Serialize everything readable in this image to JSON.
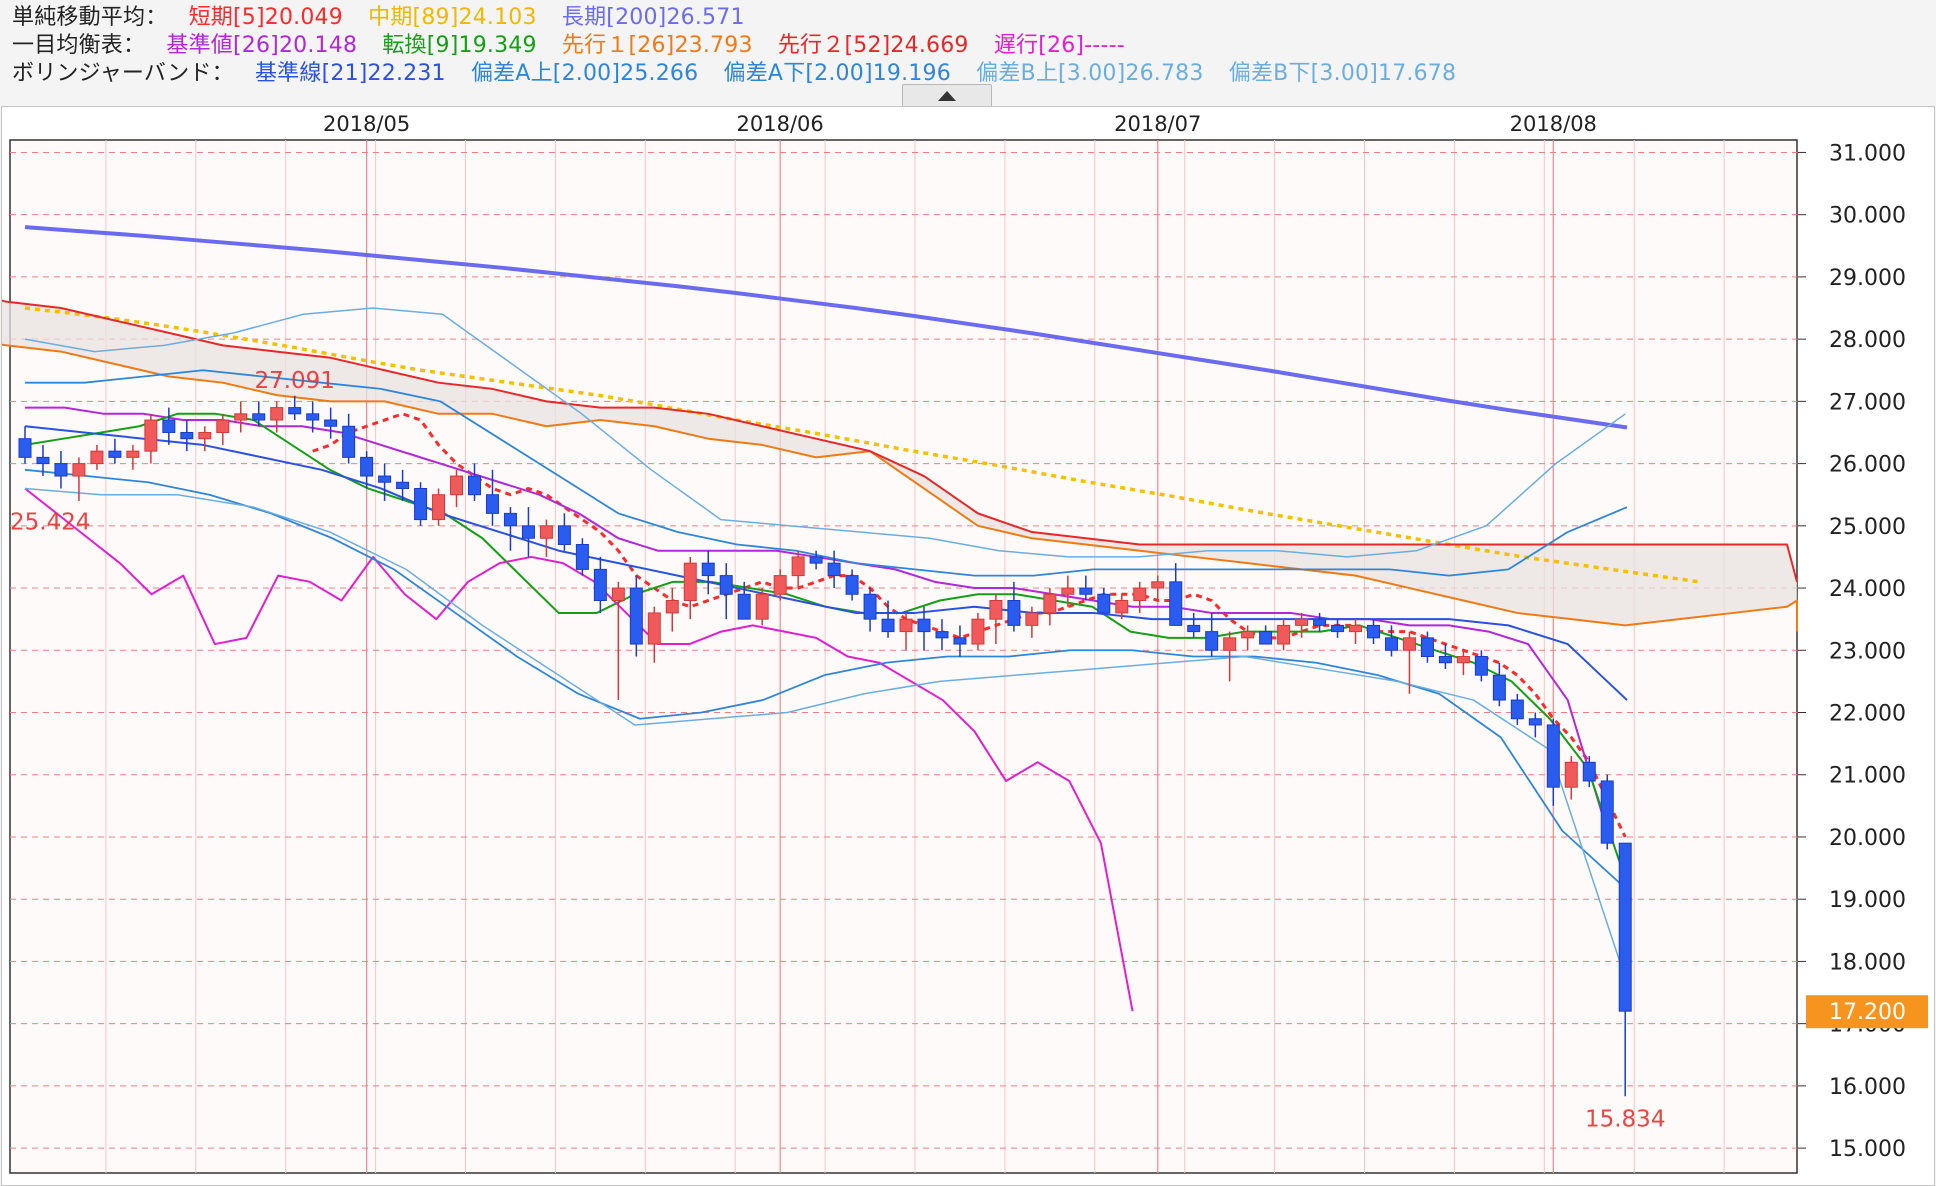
{
  "legend": {
    "sma": {
      "label": "単純移動平均：",
      "items": [
        {
          "text": "短期[5]20.049",
          "color": "#ff2a2a"
        },
        {
          "text": "中期[89]24.103",
          "color": "#f2b700"
        },
        {
          "text": "長期[200]26.571",
          "color": "#6b6bf0"
        }
      ]
    },
    "ichimoku": {
      "label": "一目均衡表：",
      "items": [
        {
          "text": "基準値[26]20.148",
          "color": "#b028d8"
        },
        {
          "text": "転換[9]19.349",
          "color": "#14a014"
        },
        {
          "text": "先行１[26]23.793",
          "color": "#f07a14"
        },
        {
          "text": "先行２[52]24.669",
          "color": "#e82828"
        },
        {
          "text": "遅行[26]-----",
          "color": "#e020d0"
        }
      ]
    },
    "bollinger": {
      "label": "ボリンジャーバンド：",
      "items": [
        {
          "text": "基準線[21]22.231",
          "color": "#2a52e0"
        },
        {
          "text": "偏差A上[2.00]25.266",
          "color": "#2e86d8"
        },
        {
          "text": "偏差A下[2.00]19.196",
          "color": "#2e86d8"
        },
        {
          "text": "偏差B上[3.00]26.783",
          "color": "#6aaee0"
        },
        {
          "text": "偏差B下[3.00]17.678",
          "color": "#6aaee0"
        }
      ]
    }
  },
  "colors": {
    "up_candle": "#f05a5a",
    "down_candle": "#2a5cf0",
    "grid": "#f08080",
    "price_badge_bg": "#f7941d",
    "annotation": "#e83030"
  },
  "chart_data": {
    "type": "candlestick",
    "ylim": [
      14.6,
      31.2
    ],
    "y_ticks": [
      "31.000",
      "30.000",
      "29.000",
      "28.000",
      "27.000",
      "26.000",
      "25.000",
      "24.000",
      "23.000",
      "22.000",
      "21.000",
      "20.000",
      "19.000",
      "18.000",
      "17.000",
      "16.000",
      "15.000"
    ],
    "x_labels": [
      {
        "text": "2018/05",
        "index": 19
      },
      {
        "text": "2018/06",
        "index": 42
      },
      {
        "text": "2018/07",
        "index": 63
      },
      {
        "text": "2018/08",
        "index": 85
      }
    ],
    "current_price": "17.200",
    "annotations": [
      {
        "text": "27.091",
        "index": 15,
        "value": 27.09,
        "pos": "above"
      },
      {
        "text": "25.424",
        "index": 0,
        "value": 25.42,
        "pos": "below"
      },
      {
        "text": "15.834",
        "index": 89,
        "value": 15.83,
        "pos": "below"
      }
    ],
    "ohlc": [
      [
        26.4,
        26.6,
        26.0,
        26.1
      ],
      [
        26.1,
        26.3,
        25.8,
        26.0
      ],
      [
        26.0,
        26.2,
        25.6,
        25.8
      ],
      [
        25.8,
        26.1,
        25.4,
        26.0
      ],
      [
        26.0,
        26.3,
        25.9,
        26.2
      ],
      [
        26.2,
        26.4,
        26.0,
        26.1
      ],
      [
        26.1,
        26.3,
        25.9,
        26.2
      ],
      [
        26.2,
        26.8,
        26.0,
        26.7
      ],
      [
        26.7,
        26.9,
        26.3,
        26.5
      ],
      [
        26.5,
        26.7,
        26.2,
        26.4
      ],
      [
        26.4,
        26.6,
        26.2,
        26.5
      ],
      [
        26.5,
        26.8,
        26.3,
        26.7
      ],
      [
        26.7,
        27.0,
        26.5,
        26.8
      ],
      [
        26.8,
        27.0,
        26.6,
        26.7
      ],
      [
        26.7,
        27.0,
        26.5,
        26.9
      ],
      [
        26.9,
        27.09,
        26.7,
        26.8
      ],
      [
        26.8,
        27.0,
        26.5,
        26.7
      ],
      [
        26.7,
        26.9,
        26.4,
        26.6
      ],
      [
        26.6,
        26.8,
        26.0,
        26.1
      ],
      [
        26.1,
        26.2,
        25.6,
        25.8
      ],
      [
        25.8,
        26.0,
        25.4,
        25.7
      ],
      [
        25.7,
        25.9,
        25.4,
        25.6
      ],
      [
        25.6,
        25.7,
        25.0,
        25.1
      ],
      [
        25.1,
        25.6,
        25.0,
        25.5
      ],
      [
        25.5,
        25.9,
        25.3,
        25.8
      ],
      [
        25.8,
        26.0,
        25.4,
        25.5
      ],
      [
        25.5,
        25.9,
        25.0,
        25.2
      ],
      [
        25.2,
        25.3,
        24.6,
        25.0
      ],
      [
        25.0,
        25.3,
        24.5,
        24.8
      ],
      [
        24.8,
        25.1,
        24.5,
        25.0
      ],
      [
        25.0,
        25.2,
        24.6,
        24.7
      ],
      [
        24.7,
        24.8,
        24.2,
        24.3
      ],
      [
        24.3,
        24.5,
        23.6,
        23.8
      ],
      [
        23.8,
        24.1,
        22.2,
        24.0
      ],
      [
        24.0,
        24.2,
        22.9,
        23.1
      ],
      [
        23.1,
        23.7,
        22.8,
        23.6
      ],
      [
        23.6,
        24.0,
        23.3,
        23.8
      ],
      [
        23.8,
        24.5,
        23.5,
        24.4
      ],
      [
        24.4,
        24.6,
        23.9,
        24.2
      ],
      [
        24.2,
        24.4,
        23.5,
        23.9
      ],
      [
        23.9,
        24.1,
        23.5,
        23.5
      ],
      [
        23.5,
        24.0,
        23.4,
        23.9
      ],
      [
        23.9,
        24.3,
        23.8,
        24.2
      ],
      [
        24.2,
        24.6,
        24.0,
        24.5
      ],
      [
        24.5,
        24.6,
        24.3,
        24.4
      ],
      [
        24.4,
        24.6,
        24.0,
        24.2
      ],
      [
        24.2,
        24.3,
        23.8,
        23.9
      ],
      [
        23.9,
        24.0,
        23.3,
        23.5
      ],
      [
        23.5,
        23.8,
        23.2,
        23.3
      ],
      [
        23.3,
        23.6,
        23.0,
        23.5
      ],
      [
        23.5,
        23.7,
        23.0,
        23.3
      ],
      [
        23.3,
        23.5,
        23.0,
        23.2
      ],
      [
        23.2,
        23.4,
        22.9,
        23.1
      ],
      [
        23.1,
        23.6,
        23.0,
        23.5
      ],
      [
        23.5,
        23.9,
        23.1,
        23.8
      ],
      [
        23.8,
        24.1,
        23.3,
        23.4
      ],
      [
        23.4,
        23.7,
        23.2,
        23.6
      ],
      [
        23.6,
        24.0,
        23.4,
        23.9
      ],
      [
        23.9,
        24.2,
        23.7,
        24.0
      ],
      [
        24.0,
        24.2,
        23.8,
        23.9
      ],
      [
        23.9,
        24.0,
        23.6,
        23.6
      ],
      [
        23.6,
        23.9,
        23.5,
        23.8
      ],
      [
        23.8,
        24.1,
        23.6,
        24.0
      ],
      [
        24.0,
        24.2,
        23.8,
        24.1
      ],
      [
        24.1,
        24.4,
        23.6,
        23.4
      ],
      [
        23.4,
        23.6,
        23.2,
        23.3
      ],
      [
        23.3,
        23.6,
        22.9,
        23.0
      ],
      [
        23.0,
        23.3,
        22.5,
        23.2
      ],
      [
        23.2,
        23.4,
        23.0,
        23.3
      ],
      [
        23.3,
        23.4,
        23.1,
        23.1
      ],
      [
        23.1,
        23.5,
        23.0,
        23.4
      ],
      [
        23.4,
        23.6,
        23.2,
        23.5
      ],
      [
        23.5,
        23.6,
        23.3,
        23.4
      ],
      [
        23.4,
        23.5,
        23.2,
        23.3
      ],
      [
        23.3,
        23.5,
        23.1,
        23.4
      ],
      [
        23.4,
        23.5,
        23.1,
        23.2
      ],
      [
        23.2,
        23.4,
        22.9,
        23.0
      ],
      [
        23.0,
        23.3,
        22.3,
        23.2
      ],
      [
        23.2,
        23.3,
        22.8,
        22.9
      ],
      [
        22.9,
        23.1,
        22.7,
        22.8
      ],
      [
        22.8,
        23.0,
        22.6,
        22.9
      ],
      [
        22.9,
        23.0,
        22.5,
        22.6
      ],
      [
        22.6,
        22.8,
        22.1,
        22.2
      ],
      [
        22.2,
        22.3,
        21.8,
        21.9
      ],
      [
        21.9,
        22.0,
        21.6,
        21.8
      ],
      [
        21.8,
        21.9,
        20.5,
        20.8
      ],
      [
        20.8,
        21.3,
        20.6,
        21.2
      ],
      [
        21.2,
        21.3,
        20.8,
        20.9
      ],
      [
        20.9,
        21.0,
        19.8,
        19.9
      ],
      [
        19.9,
        19.9,
        15.834,
        17.2
      ]
    ],
    "series": [
      {
        "name": "短期[5]",
        "color": "#ff2a2a",
        "width": 3,
        "dash": "6 5",
        "offset": 4,
        "values": [
          26.2,
          26.3,
          26.5,
          26.6,
          26.7,
          26.8,
          26.7,
          26.3,
          26.0,
          25.8,
          25.6,
          25.5,
          25.6,
          25.5,
          25.3,
          25.1,
          24.9,
          24.6,
          24.2,
          24.0,
          23.8,
          23.7,
          23.8,
          23.9,
          24.0,
          24.1,
          24.0,
          24.0,
          24.1,
          24.2,
          24.2,
          24.0,
          23.7,
          23.5,
          23.4,
          23.3,
          23.2,
          23.3,
          23.4,
          23.5,
          23.6,
          23.6,
          23.7,
          23.8,
          23.9,
          23.9,
          23.9,
          23.8,
          23.8,
          23.9,
          23.8,
          23.5,
          23.3,
          23.2,
          23.2,
          23.3,
          23.4,
          23.4,
          23.4,
          23.3,
          23.3,
          23.3,
          23.2,
          23.1,
          23.0,
          22.9,
          22.8,
          22.6,
          22.3,
          21.9,
          21.6,
          21.2,
          20.6,
          20.0
        ]
      },
      {
        "name": "中期[89]",
        "color": "#f5c000",
        "width": 3.5,
        "dash": "5 5",
        "offset": 0,
        "values": [
          28.5,
          28.42,
          28.33,
          28.23,
          28.12,
          28.0,
          27.88,
          27.75,
          27.62,
          27.5,
          27.4,
          27.3,
          27.2,
          27.1,
          26.98,
          26.85,
          26.72,
          26.6,
          26.48,
          26.35,
          26.22,
          26.1,
          25.98,
          25.85,
          25.72,
          25.6,
          25.48,
          25.35,
          25.22,
          25.1,
          24.98,
          24.86,
          24.74,
          24.62,
          24.5,
          24.4,
          24.3,
          24.2,
          24.1
        ]
      },
      {
        "name": "長期[200]",
        "color": "#6b6bf0",
        "width": 4,
        "dash": "",
        "offset": 0,
        "values": [
          29.8,
          29.73,
          29.66,
          29.58,
          29.5,
          29.42,
          29.33,
          29.24,
          29.15,
          29.05,
          28.95,
          28.85,
          28.74,
          28.62,
          28.5,
          28.37,
          28.23,
          28.09,
          27.94,
          27.79,
          27.64,
          27.49,
          27.33,
          27.17,
          27.01,
          26.86,
          26.72,
          26.58
        ]
      },
      {
        "name": "基準値[26]",
        "color": "#b028d8",
        "width": 2,
        "dash": "",
        "offset": 0,
        "values": [
          26.9,
          26.9,
          26.8,
          26.8,
          26.7,
          26.7,
          26.6,
          26.6,
          26.5,
          26.3,
          26.1,
          25.9,
          25.7,
          25.5,
          25.2,
          24.8,
          24.6,
          24.6,
          24.6,
          24.6,
          24.5,
          24.4,
          24.3,
          24.1,
          24.0,
          24.0,
          23.9,
          23.8,
          23.7,
          23.7,
          23.6,
          23.6,
          23.6,
          23.5,
          23.5,
          23.4,
          23.4,
          23.3,
          23.1,
          22.2,
          20.1
        ]
      },
      {
        "name": "転換[9]",
        "color": "#14a014",
        "width": 2,
        "dash": "",
        "offset": 0,
        "values": [
          26.3,
          26.4,
          26.5,
          26.6,
          26.8,
          26.8,
          26.7,
          26.3,
          25.9,
          25.6,
          25.4,
          25.2,
          24.8,
          24.2,
          23.6,
          23.6,
          23.9,
          24.1,
          24.1,
          24.0,
          23.9,
          23.7,
          23.6,
          23.6,
          23.8,
          23.9,
          23.9,
          23.8,
          23.7,
          23.3,
          23.2,
          23.2,
          23.3,
          23.3,
          23.3,
          23.4,
          23.2,
          23.0,
          22.8,
          22.5,
          21.9,
          21.1,
          19.3
        ]
      },
      {
        "name": "先行１[26]",
        "color": "#f07a14",
        "width": 2,
        "dash": "",
        "offset": 0,
        "values": [
          28.0,
          27.9,
          27.8,
          27.6,
          27.4,
          27.3,
          27.1,
          27.0,
          27.0,
          26.8,
          26.8,
          26.6,
          26.7,
          26.6,
          26.4,
          26.3,
          26.1,
          26.2,
          25.6,
          25.0,
          24.8,
          24.7,
          24.6,
          24.5,
          24.4,
          24.3,
          24.2,
          24.0,
          23.8,
          23.6,
          23.5,
          23.4,
          23.5,
          23.6,
          23.7,
          23.8,
          23.7,
          23.6,
          23.3
        ]
      },
      {
        "name": "先行２[52]",
        "color": "#e82828",
        "width": 2,
        "dash": "",
        "offset": 0,
        "values": [
          28.8,
          28.6,
          28.5,
          28.3,
          28.1,
          27.9,
          27.8,
          27.7,
          27.5,
          27.3,
          27.2,
          27.0,
          26.9,
          26.9,
          26.8,
          26.6,
          26.4,
          26.2,
          25.8,
          25.2,
          24.9,
          24.8,
          24.7,
          24.7,
          24.7,
          24.7,
          24.7,
          24.7,
          24.7,
          24.7,
          24.7,
          24.7,
          24.7,
          24.7,
          24.7,
          24.1,
          24.1,
          24.1,
          24.1
        ]
      },
      {
        "name": "遅行[26]",
        "color": "#e020d0",
        "width": 2,
        "dash": "",
        "offset": 0,
        "values": [
          25.6,
          25.2,
          24.8,
          24.4,
          23.9,
          24.2,
          23.1,
          23.2,
          24.2,
          24.1,
          23.8,
          24.5,
          23.9,
          23.5,
          24.1,
          24.4,
          24.5,
          24.4,
          24.1,
          23.6,
          23.1,
          23.1,
          23.3,
          23.4,
          23.3,
          23.2,
          22.9,
          22.8,
          22.5,
          22.2,
          21.7,
          20.9,
          21.2,
          20.9,
          19.9,
          17.2
        ]
      },
      {
        "name": "基準線[21]",
        "color": "#2a52e0",
        "width": 2,
        "dash": "",
        "offset": 0,
        "values": [
          26.6,
          26.5,
          26.4,
          26.3,
          26.1,
          25.9,
          25.6,
          25.2,
          24.9,
          24.6,
          24.4,
          24.2,
          24.0,
          23.8,
          23.6,
          23.6,
          23.7,
          23.6,
          23.6,
          23.5,
          23.5,
          23.5,
          23.5,
          23.5,
          23.5,
          23.4,
          23.1,
          22.2
        ]
      },
      {
        "name": "偏差A上[2.00]",
        "color": "#2e86d8",
        "width": 1.8,
        "dash": "",
        "offset": 0,
        "values": [
          27.3,
          27.3,
          27.4,
          27.5,
          27.4,
          27.3,
          27.2,
          27.0,
          26.4,
          25.8,
          25.2,
          24.9,
          24.7,
          24.6,
          24.4,
          24.3,
          24.2,
          24.2,
          24.3,
          24.3,
          24.3,
          24.3,
          24.3,
          24.3,
          24.2,
          24.3,
          24.9,
          25.3
        ]
      },
      {
        "name": "偏差A下[2.00]",
        "color": "#2e86d8",
        "width": 1.8,
        "dash": "",
        "offset": 0,
        "values": [
          25.9,
          25.8,
          25.7,
          25.5,
          25.2,
          24.8,
          24.3,
          23.6,
          22.9,
          22.3,
          21.9,
          22.0,
          22.2,
          22.6,
          22.8,
          22.9,
          22.9,
          23.0,
          23.0,
          22.9,
          22.9,
          22.8,
          22.6,
          22.3,
          21.6,
          20.1,
          19.2
        ]
      },
      {
        "name": "偏差B上[3.00]",
        "color": "#6aaee0",
        "width": 1.5,
        "dash": "",
        "offset": 0,
        "values": [
          28.0,
          27.8,
          27.9,
          28.1,
          28.4,
          28.5,
          28.4,
          27.6,
          26.8,
          25.9,
          25.1,
          25.0,
          24.9,
          24.8,
          24.6,
          24.5,
          24.5,
          24.6,
          24.6,
          24.5,
          24.6,
          25.0,
          26.0,
          26.8
        ]
      },
      {
        "name": "偏差B下[3.00]",
        "color": "#6aaee0",
        "width": 1.5,
        "dash": "",
        "offset": 0,
        "values": [
          25.6,
          25.5,
          25.5,
          25.3,
          24.9,
          24.3,
          23.4,
          22.6,
          21.8,
          21.9,
          22.0,
          22.3,
          22.5,
          22.6,
          22.7,
          22.8,
          22.9,
          22.7,
          22.5,
          22.2,
          21.4,
          17.7
        ]
      }
    ]
  }
}
